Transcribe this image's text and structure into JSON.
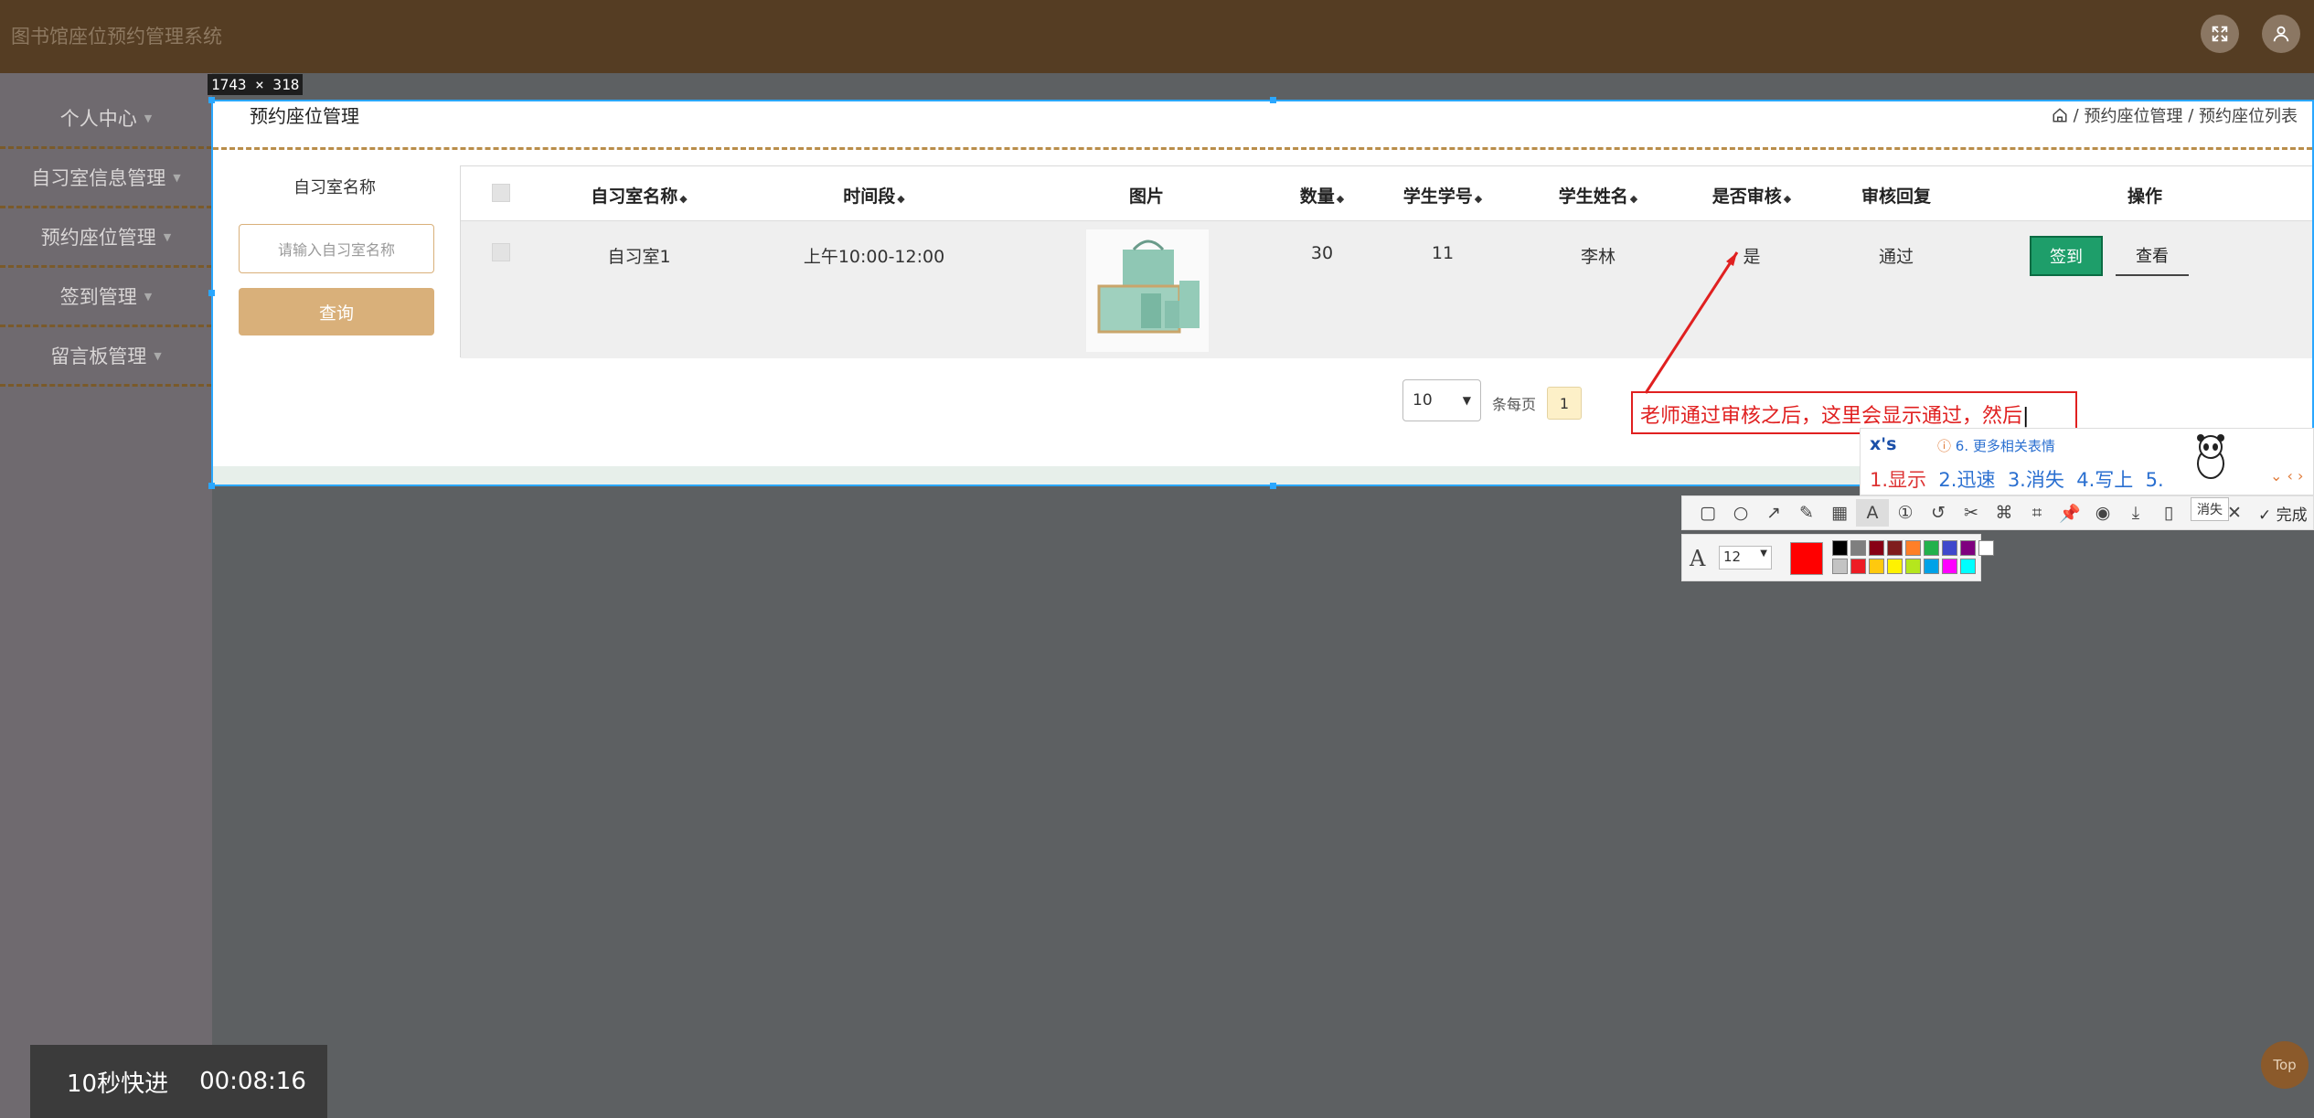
{
  "app": {
    "title": "图书馆座位预约管理系统",
    "icons": [
      "fullscreen-icon",
      "user-avatar-icon"
    ]
  },
  "sidebar": {
    "items": [
      {
        "label": "个人中心"
      },
      {
        "label": "自习室信息管理"
      },
      {
        "label": "预约座位管理"
      },
      {
        "label": "签到管理"
      },
      {
        "label": "留言板管理"
      }
    ]
  },
  "capture": {
    "size_label": "1743 × 318"
  },
  "page": {
    "heading": "预约座位管理",
    "breadcrumb": [
      "预约座位管理",
      "预约座位列表"
    ],
    "breadcrumb_sep": "/"
  },
  "search": {
    "label": "自习室名称",
    "placeholder": "请输入自习室名称",
    "button": "查询"
  },
  "table": {
    "columns": [
      "自习室名称",
      "时间段",
      "图片",
      "数量",
      "学生学号",
      "学生姓名",
      "是否审核",
      "审核回复",
      "操作"
    ],
    "rows": [
      {
        "room": "自习室1",
        "period": "上午10:00-12:00",
        "image": "product-photo",
        "count": "30",
        "student_id": "11",
        "student_name": "李林",
        "reviewed": "是",
        "reply": "通过",
        "actions": [
          "签到",
          "查看"
        ]
      }
    ]
  },
  "pagination": {
    "page_size": "10",
    "page_size_label": "条每页",
    "current_page": "1"
  },
  "annotation": {
    "text": "老师通过审核之后，这里会显示通过，然后",
    "color": "#e02020"
  },
  "ime": {
    "pinyin": "x's",
    "hint": "6. 更多相关表情",
    "candidates": [
      "1.显示",
      "2.迅速",
      "3.消失",
      "4.写上",
      "5."
    ]
  },
  "toolbar": {
    "tooltip": "消失",
    "done_label": "完成",
    "font_size": "12",
    "current_color": "#ff0000",
    "palette": [
      "#000000",
      "#7f7f7f",
      "#880015",
      "#7f1d1d",
      "#ff7f27",
      "#22b14c",
      "#3f48cc",
      "#7f007f",
      "#ffffff",
      "#c3c3c3",
      "#ed1c24",
      "#ffc90e",
      "#fff200",
      "#b5e61d",
      "#00a2e8",
      "#ff00ff",
      "#00ffff"
    ]
  },
  "video": {
    "skip_label": "10秒快进",
    "timestamp": "00:08:16"
  },
  "back_to_top": "Top"
}
